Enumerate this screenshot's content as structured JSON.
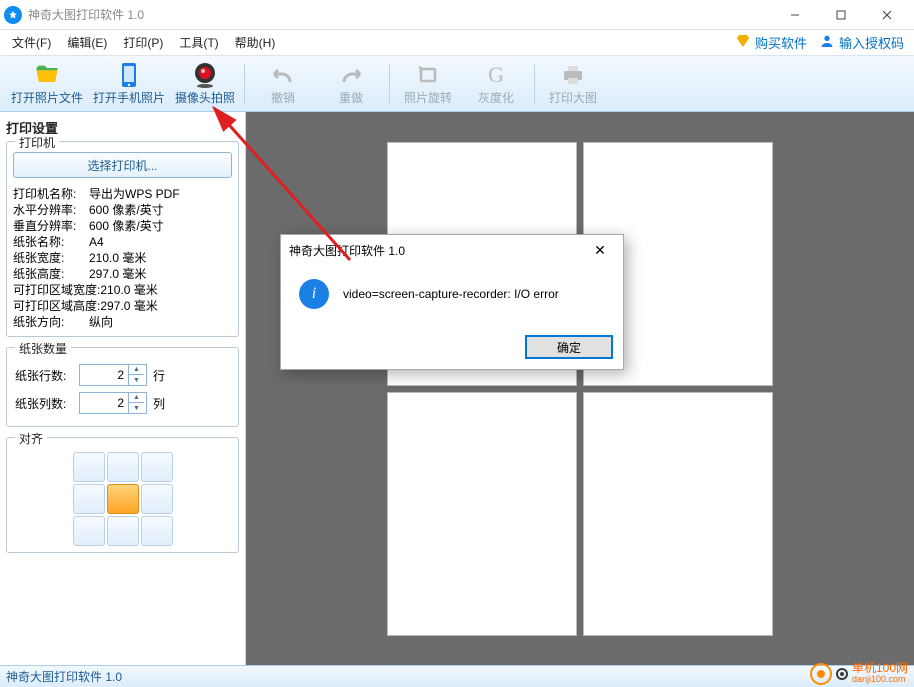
{
  "titlebar": {
    "title": "神奇大图打印软件 1.0"
  },
  "menubar": {
    "items": [
      "文件(F)",
      "编辑(E)",
      "打印(P)",
      "工具(T)",
      "帮助(H)"
    ],
    "buy": "购买软件",
    "authcode": "输入授权码"
  },
  "toolbar": {
    "open_photo": "打开照片文件",
    "open_phone": "打开手机照片",
    "camera": "摄像头拍照",
    "undo": "撤销",
    "redo": "重做",
    "rotate": "照片旋转",
    "gray": "灰度化",
    "print_big": "打印大图"
  },
  "sidebar": {
    "panel_title": "打印设置",
    "printer_group": "打印机",
    "select_printer_btn": "选择打印机...",
    "info": [
      {
        "k": "打印机名称:",
        "v": "导出为WPS PDF"
      },
      {
        "k": "水平分辨率:",
        "v": "600 像素/英寸"
      },
      {
        "k": "垂直分辨率:",
        "v": "600 像素/英寸"
      },
      {
        "k": "纸张名称:",
        "v": "A4"
      },
      {
        "k": "纸张宽度:",
        "v": "210.0 毫米"
      },
      {
        "k": "纸张高度:",
        "v": "297.0 毫米"
      },
      {
        "k": "可打印区域宽度:",
        "v": "210.0 毫米"
      },
      {
        "k": "可打印区域高度:",
        "v": "297.0 毫米"
      },
      {
        "k": "纸张方向:",
        "v": "纵向"
      }
    ],
    "paper_count_group": "纸张数量",
    "rows_label": "纸张行数:",
    "rows_value": "2",
    "rows_unit": "行",
    "cols_label": "纸张列数:",
    "cols_value": "2",
    "cols_unit": "列",
    "align_group": "对齐",
    "align_selected": 4
  },
  "dialog": {
    "title": "神奇大图打印软件 1.0",
    "message": "video=screen-capture-recorder: I/O error",
    "ok": "确定"
  },
  "statusbar": {
    "text": "神奇大图打印软件 1.0"
  },
  "watermark": {
    "cn": "单机100网",
    "en": "danji100.com"
  }
}
